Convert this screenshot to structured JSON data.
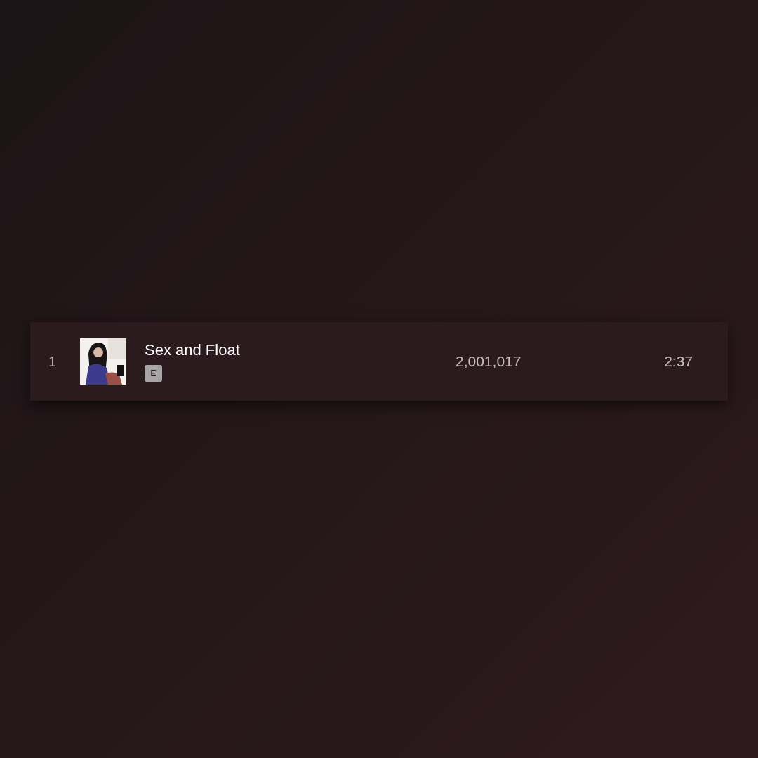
{
  "track": {
    "number": "1",
    "title": "Sex and Float",
    "explicit_badge": "E",
    "plays": "2,001,017",
    "duration": "2:37"
  }
}
